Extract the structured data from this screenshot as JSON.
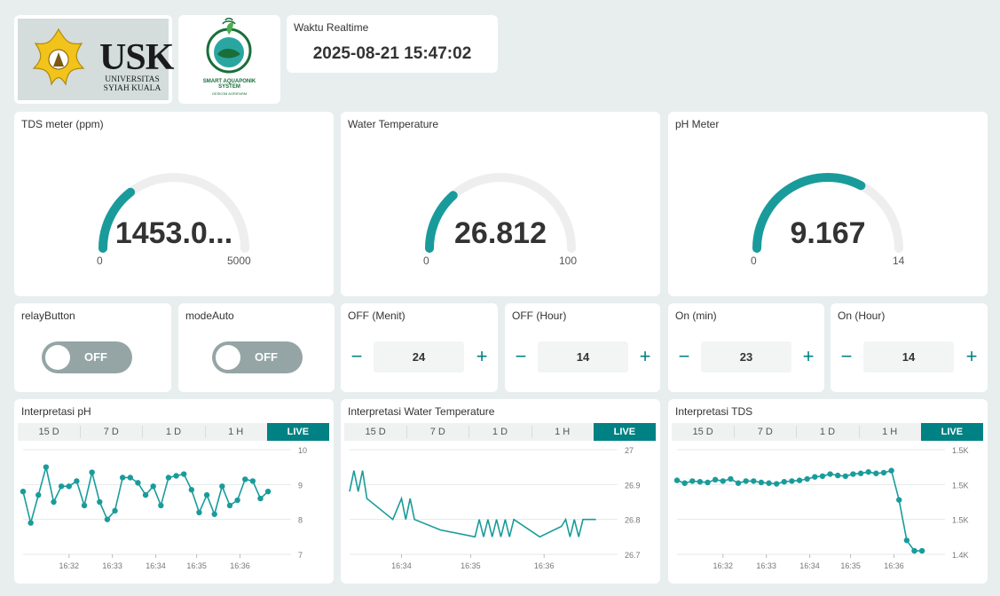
{
  "branding": {
    "usk_abbr": "USK",
    "usk_line1": "UNIVERSITAS",
    "usk_line2": "SYIAH KUALA",
    "aqua_line1": "SMART AQUAPONIK",
    "aqua_line2": "SYSTEM",
    "aqua_line3": "GESKOM AGRIFARM"
  },
  "realtime": {
    "title": "Waktu Realtime",
    "value": "2025-08-21 15:47:02"
  },
  "gauges": [
    {
      "title": "TDS meter (ppm)",
      "display": "1453.0...",
      "value": 1453.0,
      "min": 0,
      "max": 5000,
      "min_label": "0",
      "max_label": "5000"
    },
    {
      "title": "Water Temperature",
      "display": "26.812",
      "value": 26.812,
      "min": 0,
      "max": 100,
      "min_label": "0",
      "max_label": "100"
    },
    {
      "title": "pH Meter",
      "display": "9.167",
      "value": 9.167,
      "min": 0,
      "max": 14,
      "min_label": "0",
      "max_label": "14"
    }
  ],
  "switches": [
    {
      "title": "relayButton",
      "state": "OFF"
    },
    {
      "title": "modeAuto",
      "state": "OFF"
    }
  ],
  "steppers": [
    {
      "title": "OFF (Menit)",
      "value": "24"
    },
    {
      "title": "OFF (Hour)",
      "value": "14"
    },
    {
      "title": "On (min)",
      "value": "23"
    },
    {
      "title": "On (Hour)",
      "value": "14"
    }
  ],
  "stepper_symbols": {
    "minus": "−",
    "plus": "+"
  },
  "chart_tabs": [
    "15 D",
    "7 D",
    "1 D",
    "1 H",
    "LIVE"
  ],
  "active_tab": "LIVE",
  "colors": {
    "accent": "#008184",
    "series": "#1a9b9b",
    "track": "#eeeeee",
    "switch_off": "#95a5a6"
  },
  "chart_data": [
    {
      "type": "line",
      "title": "Interpretasi pH",
      "ylim": [
        7,
        10
      ],
      "yticks": [
        7,
        8,
        9,
        10
      ],
      "ytick_labels": [
        "7",
        "8",
        "9",
        "10"
      ],
      "xlim": [
        16.515,
        16.62
      ],
      "xticks": [
        16.533,
        16.55,
        16.567,
        16.583,
        16.6
      ],
      "xtick_labels": [
        "16:32",
        "16:33",
        "16:34",
        "16:35",
        "16:36"
      ],
      "markers": true,
      "x": [
        16.515,
        16.518,
        16.521,
        16.524,
        16.527,
        16.53,
        16.533,
        16.536,
        16.539,
        16.542,
        16.545,
        16.548,
        16.551,
        16.554,
        16.557,
        16.56,
        16.563,
        16.566,
        16.569,
        16.572,
        16.575,
        16.578,
        16.581,
        16.584,
        16.587,
        16.59,
        16.593,
        16.596,
        16.599,
        16.602,
        16.605,
        16.608,
        16.611
      ],
      "y": [
        8.8,
        7.9,
        8.7,
        9.5,
        8.5,
        8.95,
        8.95,
        9.1,
        8.4,
        9.35,
        8.5,
        8.0,
        8.25,
        9.2,
        9.2,
        9.05,
        8.7,
        8.95,
        8.4,
        9.2,
        9.25,
        9.3,
        8.85,
        8.2,
        8.7,
        8.15,
        8.95,
        8.4,
        8.55,
        9.15,
        9.1,
        8.6,
        8.8
      ]
    },
    {
      "type": "line",
      "title": "Interpretasi Water Temperature",
      "ylim": [
        26.7,
        27
      ],
      "yticks": [
        26.7,
        26.8,
        26.9,
        27
      ],
      "ytick_labels": [
        "26.7",
        "26.8",
        "26.9",
        "27"
      ],
      "xlim": [
        16.555,
        16.617
      ],
      "xticks": [
        16.567,
        16.583,
        16.6
      ],
      "xtick_labels": [
        "16:34",
        "16:35",
        "16:36"
      ],
      "markers": false,
      "x": [
        16.555,
        16.556,
        16.557,
        16.558,
        16.559,
        16.565,
        16.567,
        16.568,
        16.569,
        16.57,
        16.576,
        16.584,
        16.585,
        16.586,
        16.587,
        16.588,
        16.589,
        16.59,
        16.591,
        16.592,
        16.593,
        16.599,
        16.604,
        16.605,
        16.606,
        16.607,
        16.608,
        16.609,
        16.612
      ],
      "y": [
        26.88,
        26.94,
        26.88,
        26.94,
        26.86,
        26.8,
        26.86,
        26.8,
        26.86,
        26.8,
        26.77,
        26.75,
        26.8,
        26.75,
        26.8,
        26.75,
        26.8,
        26.75,
        26.8,
        26.75,
        26.8,
        26.75,
        26.78,
        26.8,
        26.75,
        26.8,
        26.75,
        26.8,
        26.8
      ]
    },
    {
      "type": "line",
      "title": "Interpretasi TDS",
      "ylim": [
        1400,
        1550
      ],
      "yticks": [
        1400,
        1450,
        1500,
        1550
      ],
      "ytick_labels": [
        "1.4K",
        "1.5K",
        "1.5K",
        "1.5K"
      ],
      "xlim": [
        16.515,
        16.62
      ],
      "xticks": [
        16.533,
        16.55,
        16.567,
        16.583,
        16.6
      ],
      "xtick_labels": [
        "16:32",
        "16:33",
        "16:34",
        "16:35",
        "16:36"
      ],
      "markers": true,
      "x": [
        16.515,
        16.518,
        16.521,
        16.524,
        16.527,
        16.53,
        16.533,
        16.536,
        16.539,
        16.542,
        16.545,
        16.548,
        16.551,
        16.554,
        16.557,
        16.56,
        16.563,
        16.566,
        16.569,
        16.572,
        16.575,
        16.578,
        16.581,
        16.584,
        16.587,
        16.59,
        16.593,
        16.596,
        16.599,
        16.602,
        16.605,
        16.608,
        16.611
      ],
      "y": [
        1506,
        1502,
        1505,
        1504,
        1503,
        1507,
        1505,
        1508,
        1502,
        1505,
        1505,
        1503,
        1502,
        1501,
        1504,
        1505,
        1506,
        1508,
        1511,
        1512,
        1515,
        1513,
        1512,
        1515,
        1516,
        1518,
        1516,
        1517,
        1520,
        1478,
        1420,
        1405,
        1405
      ]
    }
  ]
}
